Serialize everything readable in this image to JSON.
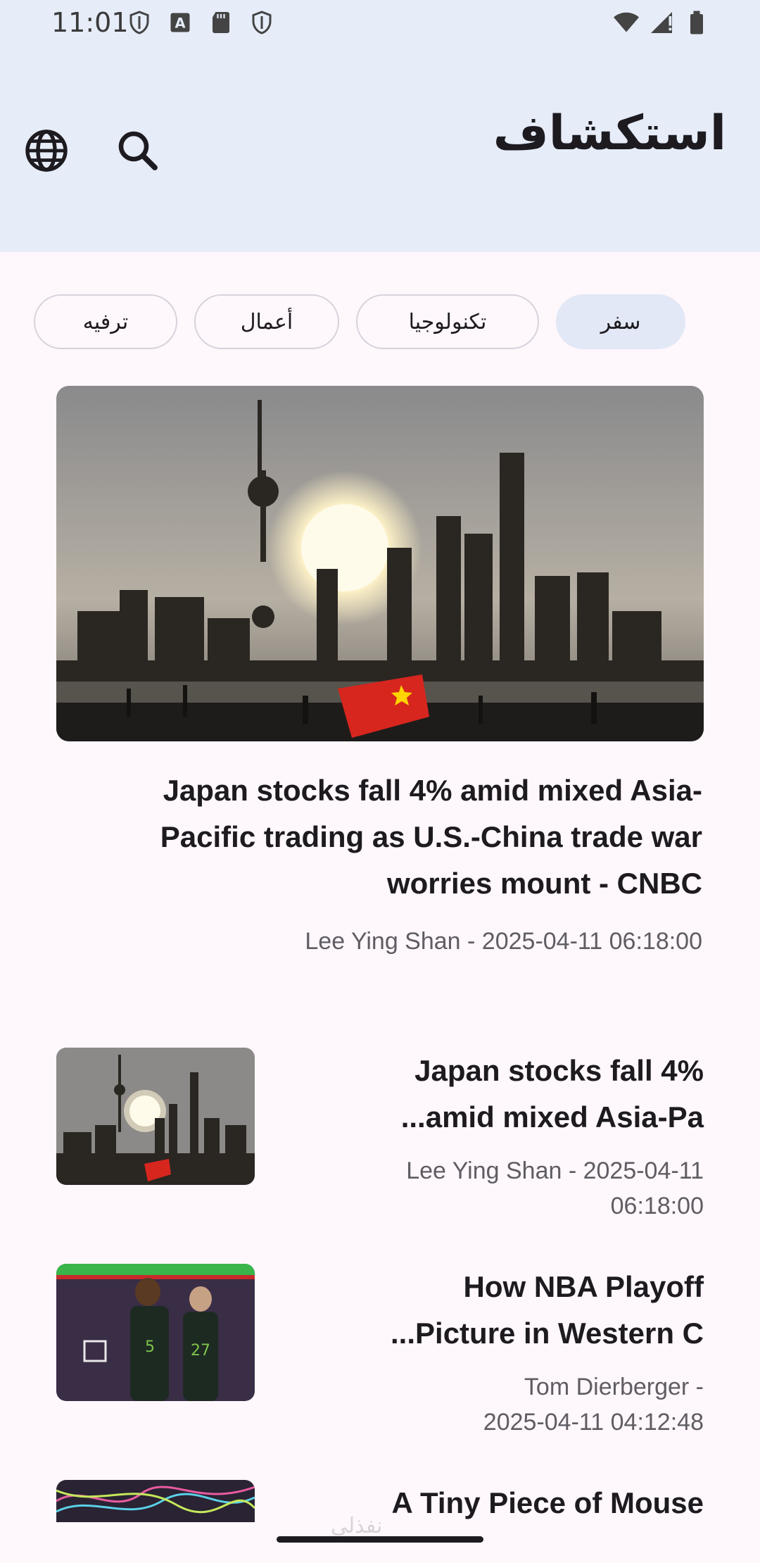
{
  "status_bar": {
    "time": "11:01",
    "left_icons": [
      "shield-icon",
      "a-badge-icon",
      "sd-card-icon",
      "shield-icon"
    ],
    "right_icons": [
      "wifi-icon",
      "signal-icon",
      "battery-icon"
    ]
  },
  "app_bar": {
    "title": "استكشاف",
    "background": "#e6ecf8"
  },
  "chips": [
    {
      "label": "سفر",
      "selected": true
    },
    {
      "label": "تكنولوجيا",
      "selected": false
    },
    {
      "label": "أعمال",
      "selected": false
    },
    {
      "label": "ترفيه",
      "selected": false
    }
  ],
  "hero": {
    "title": "Japan stocks fall 4% amid mixed Asia-Pacific trading as U.S.-China trade war worries mount - CNBC",
    "meta": "Lee Ying Shan - 2025-04-11 06:18:00"
  },
  "articles": [
    {
      "title_line1": "Japan stocks fall 4%",
      "title_line2": "...amid mixed Asia-Pa",
      "meta_line1": "Lee Ying Shan - 2025-04-11",
      "meta_line2": "06:18:00",
      "image": "city-skyline-sunset"
    },
    {
      "title_line1": "How NBA Playoff",
      "title_line2": "...Picture in Western C",
      "meta_line1": "Tom Dierberger -",
      "meta_line2": "2025-04-11 04:12:48",
      "image": "basketball-players"
    },
    {
      "title_line1": "A Tiny Piece of Mouse",
      "title_line2": "",
      "meta_line1": "",
      "meta_line2": "",
      "image": "neurons-colorful"
    }
  ],
  "watermark": "نفذلي",
  "colors": {
    "accent_chip": "#e2e8f5",
    "background": "#fef7fc",
    "meta_text": "#5f5d63"
  }
}
